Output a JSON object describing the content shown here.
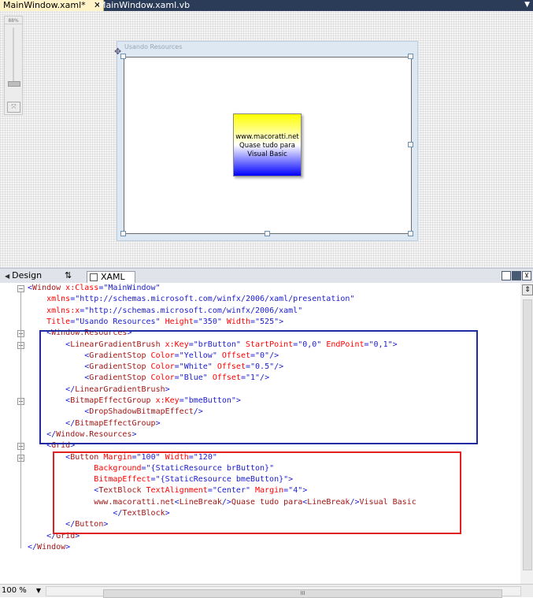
{
  "tabs": [
    {
      "label": "MainWindow.xaml*",
      "active": true
    },
    {
      "label": "MainWindow.xaml.vb",
      "active": false
    }
  ],
  "tab_close_glyph": "✕",
  "designer": {
    "zoom_indicator": "88%",
    "window_title": "Usando Resources",
    "button_lines": [
      "www.macoratti.net",
      "Quase tudo para",
      "Visual Basic"
    ],
    "gradient_colors": [
      "#FFFF00",
      "#FFFFFF",
      "#0000FF"
    ]
  },
  "view_tabs": {
    "design": "Design",
    "swap": "⇅",
    "xaml": "XAML"
  },
  "code_lines": [
    [
      {
        "c": "b",
        "t": "<"
      },
      {
        "c": "n",
        "t": "Window"
      },
      {
        "c": "r",
        "t": " x:Class"
      },
      {
        "c": "b",
        "t": "=\"MainWindow\""
      }
    ],
    [
      {
        "c": "t",
        "t": "    "
      },
      {
        "c": "r",
        "t": "xmlns"
      },
      {
        "c": "b",
        "t": "=\"http://schemas.microsoft.com/winfx/2006/xaml/presentation\""
      }
    ],
    [
      {
        "c": "t",
        "t": "    "
      },
      {
        "c": "r",
        "t": "xmlns:x"
      },
      {
        "c": "b",
        "t": "=\"http://schemas.microsoft.com/winfx/2006/xaml\""
      }
    ],
    [
      {
        "c": "t",
        "t": "    "
      },
      {
        "c": "r",
        "t": "Title"
      },
      {
        "c": "b",
        "t": "=\"Usando Resources\""
      },
      {
        "c": "r",
        "t": " Height"
      },
      {
        "c": "b",
        "t": "=\"350\""
      },
      {
        "c": "r",
        "t": " Width"
      },
      {
        "c": "b",
        "t": "=\"525\">"
      }
    ],
    [
      {
        "c": "t",
        "t": "    "
      },
      {
        "c": "b",
        "t": "<"
      },
      {
        "c": "n",
        "t": "Window.Resources"
      },
      {
        "c": "b",
        "t": ">"
      }
    ],
    [
      {
        "c": "t",
        "t": "        "
      },
      {
        "c": "b",
        "t": "<"
      },
      {
        "c": "n",
        "t": "LinearGradientBrush"
      },
      {
        "c": "r",
        "t": " x:Key"
      },
      {
        "c": "b",
        "t": "=\"brButton\""
      },
      {
        "c": "r",
        "t": " StartPoint"
      },
      {
        "c": "b",
        "t": "=\"0,0\""
      },
      {
        "c": "r",
        "t": " EndPoint"
      },
      {
        "c": "b",
        "t": "=\"0,1\">"
      }
    ],
    [
      {
        "c": "t",
        "t": "            "
      },
      {
        "c": "b",
        "t": "<"
      },
      {
        "c": "n",
        "t": "GradientStop"
      },
      {
        "c": "r",
        "t": " Color"
      },
      {
        "c": "b",
        "t": "=\"Yellow\""
      },
      {
        "c": "r",
        "t": " Offset"
      },
      {
        "c": "b",
        "t": "=\"0\"/>"
      }
    ],
    [
      {
        "c": "t",
        "t": "            "
      },
      {
        "c": "b",
        "t": "<"
      },
      {
        "c": "n",
        "t": "GradientStop"
      },
      {
        "c": "r",
        "t": " Color"
      },
      {
        "c": "b",
        "t": "=\"White\""
      },
      {
        "c": "r",
        "t": " Offset"
      },
      {
        "c": "b",
        "t": "=\"0.5\"/>"
      }
    ],
    [
      {
        "c": "t",
        "t": "            "
      },
      {
        "c": "b",
        "t": "<"
      },
      {
        "c": "n",
        "t": "GradientStop"
      },
      {
        "c": "r",
        "t": " Color"
      },
      {
        "c": "b",
        "t": "=\"Blue\""
      },
      {
        "c": "r",
        "t": " Offset"
      },
      {
        "c": "b",
        "t": "=\"1\"/>"
      }
    ],
    [
      {
        "c": "t",
        "t": "        "
      },
      {
        "c": "b",
        "t": "</"
      },
      {
        "c": "n",
        "t": "LinearGradientBrush"
      },
      {
        "c": "b",
        "t": ">"
      }
    ],
    [
      {
        "c": "t",
        "t": "        "
      },
      {
        "c": "b",
        "t": "<"
      },
      {
        "c": "n",
        "t": "BitmapEffectGroup"
      },
      {
        "c": "r",
        "t": " x:Key"
      },
      {
        "c": "b",
        "t": "=\"bmeButton\">"
      }
    ],
    [
      {
        "c": "t",
        "t": "            "
      },
      {
        "c": "b",
        "t": "<"
      },
      {
        "c": "n",
        "t": "DropShadowBitmapEffect"
      },
      {
        "c": "b",
        "t": "/>"
      }
    ],
    [
      {
        "c": "t",
        "t": "        "
      },
      {
        "c": "b",
        "t": "</"
      },
      {
        "c": "n",
        "t": "BitmapEffectGroup"
      },
      {
        "c": "b",
        "t": ">"
      }
    ],
    [
      {
        "c": "t",
        "t": "    "
      },
      {
        "c": "b",
        "t": "</"
      },
      {
        "c": "n",
        "t": "Window.Resources"
      },
      {
        "c": "b",
        "t": ">"
      }
    ],
    [
      {
        "c": "t",
        "t": "    "
      },
      {
        "c": "b",
        "t": "<"
      },
      {
        "c": "n",
        "t": "Grid"
      },
      {
        "c": "b",
        "t": ">"
      }
    ],
    [
      {
        "c": "t",
        "t": "        "
      },
      {
        "c": "b",
        "t": "<"
      },
      {
        "c": "n",
        "t": "Button"
      },
      {
        "c": "r",
        "t": " Margin"
      },
      {
        "c": "b",
        "t": "=\"100\""
      },
      {
        "c": "r",
        "t": " Width"
      },
      {
        "c": "b",
        "t": "=\"120\""
      }
    ],
    [
      {
        "c": "t",
        "t": "              "
      },
      {
        "c": "r",
        "t": "Background"
      },
      {
        "c": "b",
        "t": "=\"{StaticResource brButton}\""
      }
    ],
    [
      {
        "c": "t",
        "t": "              "
      },
      {
        "c": "r",
        "t": "BitmapEffect"
      },
      {
        "c": "b",
        "t": "=\"{StaticResource bmeButton}\">"
      }
    ],
    [
      {
        "c": "t",
        "t": "              "
      },
      {
        "c": "b",
        "t": "<"
      },
      {
        "c": "n",
        "t": "TextBlock"
      },
      {
        "c": "r",
        "t": " TextAlignment"
      },
      {
        "c": "b",
        "t": "=\"Center\""
      },
      {
        "c": "r",
        "t": " Margin"
      },
      {
        "c": "b",
        "t": "=\"4\">"
      }
    ],
    [
      {
        "c": "t",
        "t": "              "
      },
      {
        "c": "n",
        "t": "www.macoratti.net"
      },
      {
        "c": "b",
        "t": "<"
      },
      {
        "c": "n",
        "t": "LineBreak"
      },
      {
        "c": "b",
        "t": "/>"
      },
      {
        "c": "n",
        "t": "Quase tudo para"
      },
      {
        "c": "b",
        "t": "<"
      },
      {
        "c": "n",
        "t": "LineBreak"
      },
      {
        "c": "b",
        "t": "/>"
      },
      {
        "c": "n",
        "t": "Visual Basic"
      }
    ],
    [
      {
        "c": "t",
        "t": "                  "
      },
      {
        "c": "b",
        "t": "</"
      },
      {
        "c": "n",
        "t": "TextBlock"
      },
      {
        "c": "b",
        "t": ">"
      }
    ],
    [
      {
        "c": "t",
        "t": "        "
      },
      {
        "c": "b",
        "t": "</"
      },
      {
        "c": "n",
        "t": "Button"
      },
      {
        "c": "b",
        "t": ">"
      }
    ],
    [
      {
        "c": "t",
        "t": "    "
      },
      {
        "c": "b",
        "t": "</"
      },
      {
        "c": "n",
        "t": "Grid"
      },
      {
        "c": "b",
        "t": ">"
      }
    ],
    [
      {
        "c": "b",
        "t": "</"
      },
      {
        "c": "n",
        "t": "Window"
      },
      {
        "c": "b",
        "t": ">"
      }
    ]
  ],
  "fold_lines": [
    0,
    4,
    5,
    10,
    14,
    15
  ],
  "status": {
    "zoom": "100 %",
    "hscroll_grip": "III"
  },
  "colors": {
    "tag_bracket": "#1B1BCF",
    "element_name": "#A31515",
    "attribute": "#FF0000",
    "highlight_resources": "#1F2AA3",
    "highlight_button": "#E1211F"
  }
}
